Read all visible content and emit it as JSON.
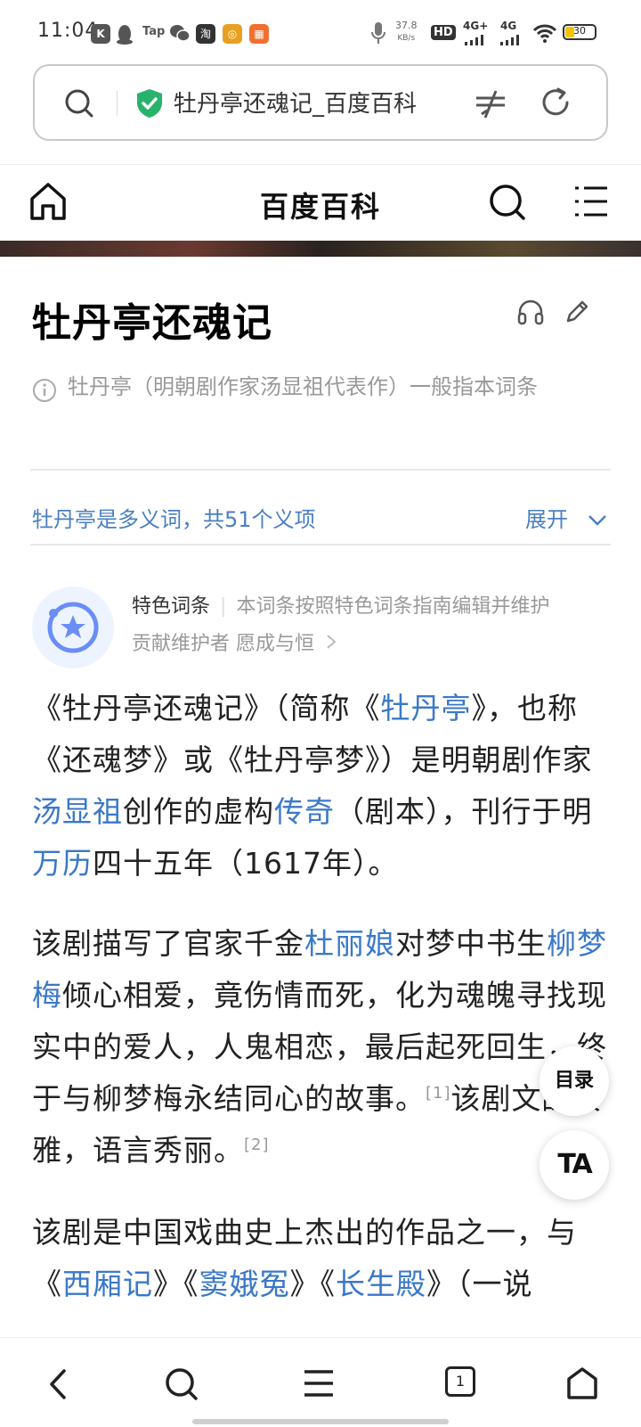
{
  "status_bar": {
    "time": "11:04",
    "app_icons": [
      "k-app-icon",
      "qq-penguin-icon",
      "tap-icon",
      "wechat-icon",
      "taobao-icon",
      "podcast-icon",
      "grid-app-icon"
    ],
    "tap_label": "Tap",
    "taobao_label": "淘",
    "net_speed_value": "37.8",
    "net_speed_unit": "KB/s",
    "hd_label": "HD",
    "sim1": "4G+",
    "sim2": "4G",
    "battery": "30",
    "colors": {
      "k": "#555555",
      "taobao": "#333333",
      "podcast": "#e8a020",
      "grid": "#f07030",
      "battery": "#f5c400"
    }
  },
  "address_bar": {
    "url_text": "牡丹亭还魂记_百度百科",
    "secure": true,
    "icons": [
      "search-icon",
      "shield-check-icon",
      "not-equal-icon",
      "refresh-icon"
    ]
  },
  "site_header": {
    "title": "百度百科",
    "icons": [
      "home-icon",
      "search-icon",
      "menu-icon"
    ]
  },
  "entry": {
    "title": "牡丹亭还魂记",
    "note": "牡丹亭（明朝剧作家汤显祖代表作）一般指本词条",
    "polysemy": "牡丹亭是多义词，共51个义项",
    "expand_label": "展开",
    "feature_label": "特色词条",
    "feature_desc": "本词条按照特色词条指南编辑并维护",
    "contributors_label": "贡献维护者",
    "contributor_name": "愿成与恒",
    "paragraphs": [
      [
        {
          "t": "《牡丹亭还魂记》（简称《"
        },
        {
          "t": "牡丹亭",
          "link": true
        },
        {
          "t": "》，也称《还魂梦》或《牡丹亭梦》）是明朝剧作家"
        },
        {
          "t": "汤显祖",
          "link": true
        },
        {
          "t": "创作的虚构"
        },
        {
          "t": "传奇",
          "link": true
        },
        {
          "t": "（剧本），刊行于明"
        },
        {
          "t": "万历",
          "link": true
        },
        {
          "t": "四十五年（1617年）。"
        }
      ],
      [
        {
          "t": "该剧描写了官家千金"
        },
        {
          "t": "杜丽娘",
          "link": true
        },
        {
          "t": "对梦中书生"
        },
        {
          "t": "柳梦梅",
          "link": true
        },
        {
          "t": "倾心相爱，竟伤情而死，化为魂魄寻找现实中的爱人，人鬼相恋，最后起死回生，终于与柳梦梅永结同心的故事。"
        },
        {
          "t": "[1]",
          "sup": true
        },
        {
          "t": "该剧文辞典雅，语言秀丽。"
        },
        {
          "t": "[2]",
          "sup": true
        }
      ],
      [
        {
          "t": "该剧是中国戏曲史上杰出的作品之一，与《"
        },
        {
          "t": "西厢记",
          "link": true
        },
        {
          "t": "》《"
        },
        {
          "t": "窦娥冤",
          "link": true
        },
        {
          "t": "》《"
        },
        {
          "t": "长生殿",
          "link": true
        },
        {
          "t": "》（一说"
        }
      ]
    ],
    "colors": {
      "link": "#3a78c8",
      "muted": "#999999",
      "accent": "#4a7fc1"
    }
  },
  "floating": {
    "toc_label": "目录",
    "ta_label": "TA"
  },
  "bottom_nav": {
    "items": [
      "back-icon",
      "search-icon",
      "menu-icon",
      "tabs-icon",
      "home-icon"
    ],
    "tabs_count": "1"
  }
}
